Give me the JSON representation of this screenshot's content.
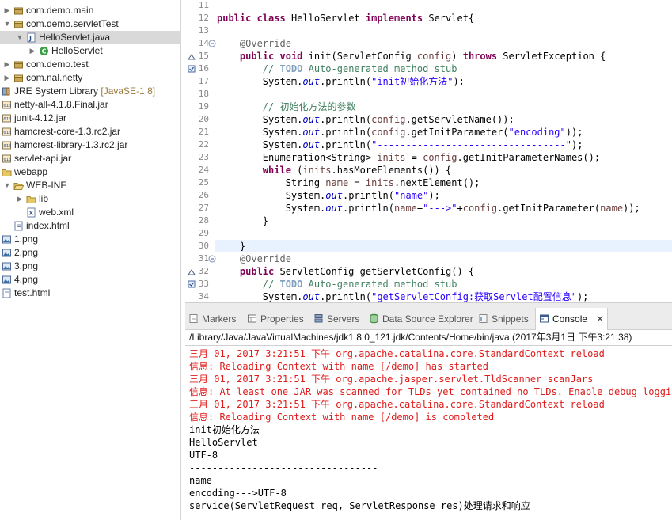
{
  "project_tree": {
    "items": [
      {
        "label": "com.demo.main",
        "icon": "package-icon",
        "expander": "▶",
        "depth": 0
      },
      {
        "label": "com.demo.servletTest",
        "icon": "package-icon",
        "expander": "▼",
        "depth": 0
      },
      {
        "label": "HelloServlet.java",
        "icon": "java-file-icon",
        "expander": "▼",
        "depth": 1,
        "selected": true
      },
      {
        "label": "HelloServlet",
        "icon": "class-icon",
        "expander": "▶",
        "depth": 2
      },
      {
        "label": "com.demo.test",
        "icon": "package-icon",
        "expander": "▶",
        "depth": 0
      },
      {
        "label": "com.nal.netty",
        "icon": "package-icon",
        "expander": "▶",
        "depth": 0
      },
      {
        "label": "JRE System Library",
        "decoration": "[JavaSE-1.8]",
        "icon": "library-icon",
        "expander": "",
        "depth": -1
      },
      {
        "label": "netty-all-4.1.8.Final.jar",
        "icon": "jar-icon",
        "expander": "",
        "depth": -1
      },
      {
        "label": "junit-4.12.jar",
        "icon": "jar-icon",
        "expander": "",
        "depth": -1
      },
      {
        "label": "hamcrest-core-1.3.rc2.jar",
        "icon": "jar-icon",
        "expander": "",
        "depth": -1
      },
      {
        "label": "hamcrest-library-1.3.rc2.jar",
        "icon": "jar-icon",
        "expander": "",
        "depth": -1
      },
      {
        "label": "servlet-api.jar",
        "icon": "jar-icon",
        "expander": "",
        "depth": -1
      },
      {
        "label": "webapp",
        "icon": "folder-icon",
        "expander": "",
        "depth": -1
      },
      {
        "label": "WEB-INF",
        "icon": "folder-open-icon",
        "expander": "▼",
        "depth": 0
      },
      {
        "label": "lib",
        "icon": "folder-icon",
        "expander": "▶",
        "depth": 1
      },
      {
        "label": "web.xml",
        "icon": "xml-file-icon",
        "expander": "",
        "depth": 1
      },
      {
        "label": "index.html",
        "icon": "html-file-icon",
        "expander": "",
        "depth": 0
      },
      {
        "label": "1.png",
        "icon": "image-file-icon",
        "expander": "",
        "depth": -1
      },
      {
        "label": "2.png",
        "icon": "image-file-icon",
        "expander": "",
        "depth": -1
      },
      {
        "label": "3.png",
        "icon": "image-file-icon",
        "expander": "",
        "depth": -1
      },
      {
        "label": "4.png",
        "icon": "image-file-icon",
        "expander": "",
        "depth": -1
      },
      {
        "label": "test.html",
        "icon": "html-file-icon",
        "expander": "",
        "depth": -1
      }
    ]
  },
  "editor": {
    "lines": [
      {
        "num": "11",
        "text": ""
      },
      {
        "num": "12",
        "text": "public class HelloServlet implements Servlet{"
      },
      {
        "num": "13",
        "text": ""
      },
      {
        "num": "14",
        "text": "    @Override",
        "fold": true
      },
      {
        "num": "15",
        "text": "    public void init(ServletConfig config) throws ServletException {",
        "marker": "override"
      },
      {
        "num": "16",
        "text": "        // TODO Auto-generated method stub",
        "marker": "task"
      },
      {
        "num": "17",
        "text": "        System.out.println(\"init初始化方法\");"
      },
      {
        "num": "18",
        "text": ""
      },
      {
        "num": "19",
        "text": "        // 初始化方法的参数"
      },
      {
        "num": "20",
        "text": "        System.out.println(config.getServletName());"
      },
      {
        "num": "21",
        "text": "        System.out.println(config.getInitParameter(\"encoding\"));"
      },
      {
        "num": "22",
        "text": "        System.out.println(\"---------------------------------\");"
      },
      {
        "num": "23",
        "text": "        Enumeration<String> inits = config.getInitParameterNames();"
      },
      {
        "num": "24",
        "text": "        while (inits.hasMoreElements()) {"
      },
      {
        "num": "25",
        "text": "            String name = inits.nextElement();"
      },
      {
        "num": "26",
        "text": "            System.out.println(\"name\");"
      },
      {
        "num": "27",
        "text": "            System.out.println(name+\"--->\"+config.getInitParameter(name));"
      },
      {
        "num": "28",
        "text": "        }"
      },
      {
        "num": "29",
        "text": ""
      },
      {
        "num": "30",
        "text": "    }",
        "current": true
      },
      {
        "num": "31",
        "text": "    @Override",
        "fold": true
      },
      {
        "num": "32",
        "text": "    public ServletConfig getServletConfig() {",
        "marker": "override"
      },
      {
        "num": "33",
        "text": "        // TODO Auto-generated method stub",
        "marker": "task"
      },
      {
        "num": "34",
        "text": "        System.out.println(\"getServletConfig:获取Servlet配置信息\");"
      }
    ]
  },
  "views": {
    "tabs": [
      {
        "label": "Markers",
        "icon": "markers-icon"
      },
      {
        "label": "Properties",
        "icon": "properties-icon"
      },
      {
        "label": "Servers",
        "icon": "servers-icon"
      },
      {
        "label": "Data Source Explorer",
        "icon": "data-source-icon"
      },
      {
        "label": "Snippets",
        "icon": "snippets-icon"
      },
      {
        "label": "Console",
        "icon": "console-icon",
        "active": true,
        "close": "✕"
      }
    ]
  },
  "console": {
    "path": "/Library/Java/JavaVirtualMachines/jdk1.8.0_121.jdk/Contents/Home/bin/java (2017年3月1日 下午3:21:38)",
    "lines": [
      {
        "text": "三月 01, 2017 3:21:51 下午 org.apache.catalina.core.StandardContext reload",
        "err": true
      },
      {
        "text": "信息: Reloading Context with name [/demo] has started",
        "err": true
      },
      {
        "text": "三月 01, 2017 3:21:51 下午 org.apache.jasper.servlet.TldScanner scanJars",
        "err": true
      },
      {
        "text": "信息: At least one JAR was scanned for TLDs yet contained no TLDs. Enable debug logging",
        "err": true
      },
      {
        "text": "三月 01, 2017 3:21:51 下午 org.apache.catalina.core.StandardContext reload",
        "err": true
      },
      {
        "text": "信息: Reloading Context with name [/demo] is completed",
        "err": true
      },
      {
        "text": "init初始化方法",
        "err": false
      },
      {
        "text": "HelloServlet",
        "err": false
      },
      {
        "text": "UTF-8",
        "err": false
      },
      {
        "text": "---------------------------------",
        "err": false
      },
      {
        "text": "name",
        "err": false
      },
      {
        "text": "encoding--->UTF-8",
        "err": false
      },
      {
        "text": "service(ServletRequest req, ServletResponse res)处理请求和响应",
        "err": false
      }
    ]
  },
  "colors": {
    "keyword": "#7f0055",
    "annotation": "#646464",
    "comment": "#3f7f5f",
    "string": "#2a00ff",
    "static_field": "#0000c0",
    "local_variable": "#6a3e3e",
    "console_error": "#e01b1b",
    "selection": "#d9d9d9",
    "current_line": "#e8f2fe"
  }
}
